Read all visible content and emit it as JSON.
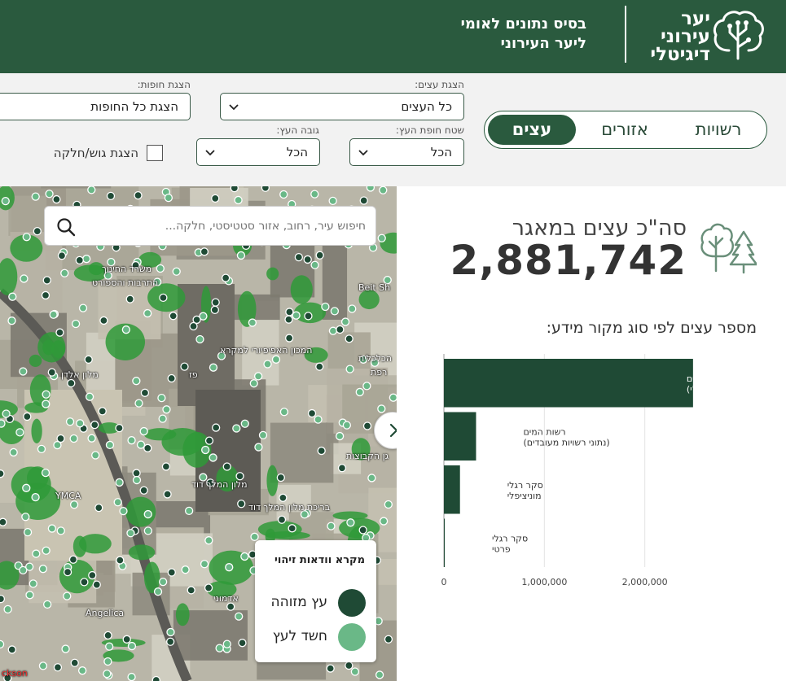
{
  "header": {
    "logo_lines": [
      "יער",
      "עירוני",
      "דיגיטלי"
    ],
    "subtitle_lines": [
      "בסיס נתונים לאומי",
      "ליער העירוני"
    ]
  },
  "filters": {
    "tabs": [
      {
        "label": "רשויות",
        "active": false
      },
      {
        "label": "אזורים",
        "active": false
      },
      {
        "label": "עצים",
        "active": true
      }
    ],
    "trees_label": "הצגת עצים:",
    "trees_value": "כל העצים",
    "canopy_label": "הצגת חופות:",
    "canopy_value": "הצגת כל החופות",
    "canopy_area_label": "שטח חופת העץ:",
    "canopy_area_value": "הכל",
    "height_label": "גובה העץ:",
    "height_value": "הכל",
    "parcel_checkbox_label": "הצגת גוש/חלקה",
    "parcel_checked": false
  },
  "map": {
    "search_placeholder": "חיפוש עיר, רחוב, אזור סטטיסטי, חלקה...",
    "labels": [
      "משרד החינוך",
      "התרבות והספורט",
      "מלון אלדן",
      "הכלכלית",
      "המכון האפיפיורי למקרא",
      "Beit Sh",
      "YMCA",
      "מלון המלך דוד",
      "בריכת מלון המלך דוד",
      "גן הקבוצות",
      "Angelica",
      "אדמוני",
      "פז",
      "רפת",
      "ckson"
    ],
    "legend": {
      "title": "מקרא וודאות זיהוי",
      "items": [
        {
          "label": "עץ מזוהה",
          "color": "#1f4a35"
        },
        {
          "label": "חשד לעץ",
          "color": "#6ab887"
        }
      ]
    }
  },
  "stats": {
    "total_label": "סה\"כ עצים במאגר",
    "total_value": "2,881,742",
    "chart_title": "מספר עצים לפי סוג מקור מידע:"
  },
  "chart_data": {
    "type": "bar",
    "orientation": "horizontal",
    "categories": [
      [
        "עיבוד חופות עצים",
        "(חישה מרחוק, מפ\"י)"
      ],
      [
        "רשות המים",
        "(נתוני רשויות מעובדים)"
      ],
      [
        "סקר רגלי",
        "מוניציפלי"
      ],
      [
        "סקר רגלי",
        "פרטי"
      ]
    ],
    "values": [
      2480000,
      320000,
      160000,
      5000
    ],
    "xlim": [
      0,
      3000000
    ],
    "xticks": [
      "0",
      "1,000,000",
      "2,000,000"
    ],
    "xtick_values": [
      0,
      1000000,
      2000000
    ],
    "bar_color": "#1f4a35",
    "grid": true
  },
  "colors": {
    "brand": "#2a5a3e",
    "tree_identified": "#1f4a35",
    "tree_suspected": "#6ab887"
  }
}
